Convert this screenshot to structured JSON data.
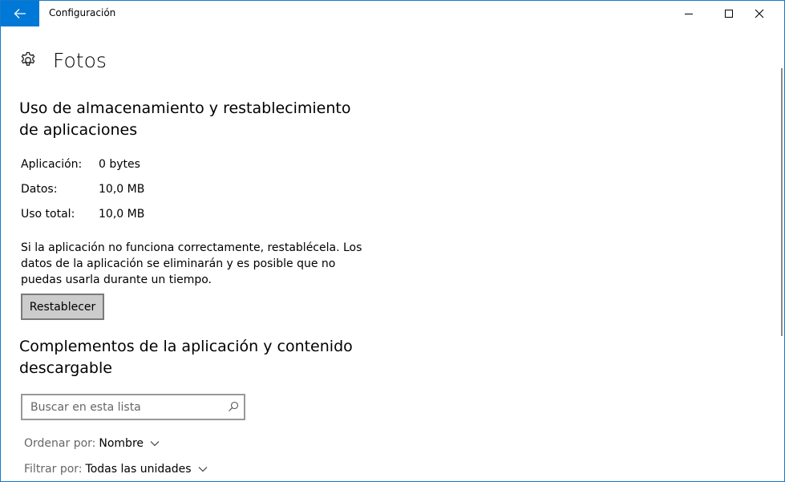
{
  "window": {
    "title": "Configuración"
  },
  "titlebar": {
    "back_icon": "back-arrow-icon",
    "minimize_icon": "minimize-icon",
    "maximize_icon": "maximize-icon",
    "close_icon": "close-icon",
    "accent_color": "#0078d7"
  },
  "header": {
    "icon": "gear-icon",
    "title": "Fotos"
  },
  "storage": {
    "title": "Uso de almacenamiento y restablecimiento de aplicaciones",
    "rows": [
      {
        "label": "Aplicación:",
        "value": "0 bytes"
      },
      {
        "label": "Datos:",
        "value": "10,0 MB"
      },
      {
        "label": "Uso total:",
        "value": "10,0 MB"
      }
    ],
    "description": "Si la aplicación no funciona correctamente, restablécela. Los datos de la aplicación se eliminarán y es posible que no puedas usarla durante un tiempo.",
    "reset_label": "Restablecer"
  },
  "addons": {
    "title": "Complementos de la aplicación y contenido descargable",
    "search": {
      "placeholder": "Buscar en esta lista",
      "value": "",
      "icon": "search-icon"
    },
    "sort": {
      "label": "Ordenar por:",
      "value": "Nombre"
    },
    "filter": {
      "label": "Filtrar por:",
      "value": "Todas las unidades"
    }
  }
}
